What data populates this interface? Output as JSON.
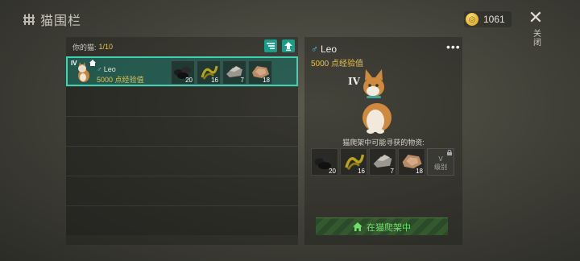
{
  "header": {
    "title": "猫围栏",
    "coins": "1061",
    "close_label": "关闭"
  },
  "list": {
    "your_cats_label": "你的猫:",
    "count": "1/10",
    "cats": [
      {
        "level": "IV",
        "name": "Leo",
        "exp": "5000 点经验值",
        "items": [
          {
            "icon": "coal-icon",
            "qty": "20"
          },
          {
            "icon": "rope-icon",
            "qty": "16"
          },
          {
            "icon": "stone-icon",
            "qty": "7"
          },
          {
            "icon": "leather-icon",
            "qty": "18"
          }
        ]
      }
    ]
  },
  "detail": {
    "name": "Leo",
    "exp": "5000 点经验值",
    "level": "IV",
    "loot_label": "猫爬架中可能寻获的物资:",
    "loot": [
      {
        "icon": "coal-icon",
        "qty": "20"
      },
      {
        "icon": "rope-icon",
        "qty": "16"
      },
      {
        "icon": "stone-icon",
        "qty": "7"
      },
      {
        "icon": "leather-icon",
        "qty": "18"
      }
    ],
    "locked_slot": {
      "level": "V",
      "label": "级别"
    },
    "action_label": "在猫爬架中"
  }
}
